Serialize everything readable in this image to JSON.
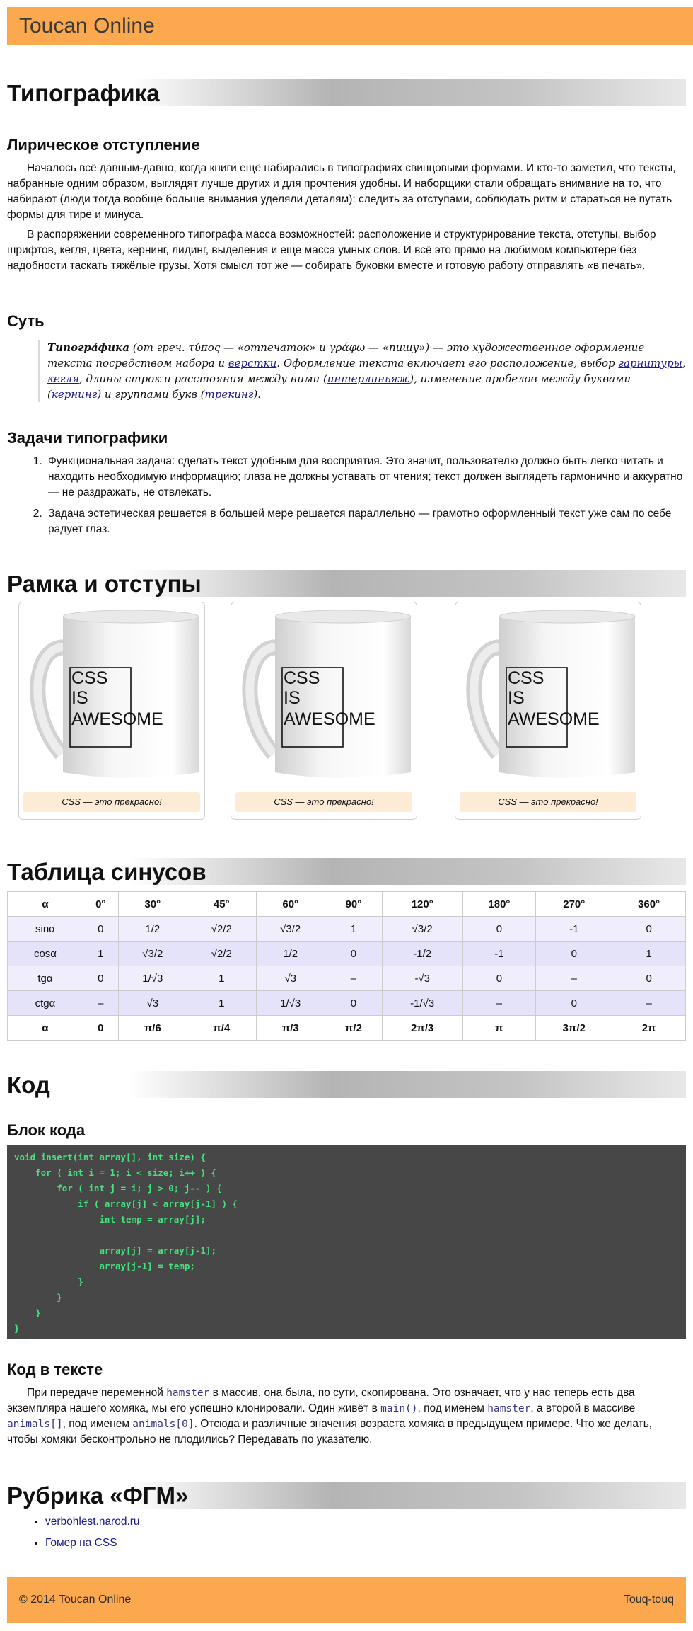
{
  "site": {
    "title": "Toucan Online"
  },
  "typography": {
    "heading": "Типографика",
    "lyric_heading": "Лирическое отступление",
    "p1": "Началось всё давным-давно, когда книги ещё набирались в типографиях свинцовыми формами. И кто-то заметил, что тексты, набранные одним образом, выглядят лучше других и для прочтения удобны. И наборщики стали обращать внимание на то, что набирают (люди тогда вообще больше внимания уделяли деталям): следить за отступами, соблюдать ритм и стараться не путать формы для тире и минуса.",
    "p2": "В распоряжении современного типографа масса возможностей: расположение и структурирование текста, отступы, выбор шрифтов, кегля, цвета, кернинг, лидинг, выделения и еще масса умных слов. И всё это прямо на любимом компьютере без надобности таскать тяжёлые грузы. Хотя смысл тот же — собирать буковки вместе и готовую работу отправлять «в печать».",
    "essence_heading": "Суть",
    "quote": {
      "term": "Типогра́фика",
      "t1": " (от греч. τύπος — «отпечаток» и γράφω — «пишу») — это художественное оформление текста посредством набора и ",
      "link_layout": "верстки",
      "t2": ". Оформление текста включает его расположение, выбор ",
      "link_typeface": "гарнитуры",
      "t3": ", ",
      "link_size": "кегля",
      "t4": ", длины строк и расстояния между ними (",
      "link_leading": "интерлиньяж",
      "t5": "), изменение пробелов между буквами (",
      "link_kerning": "кернинг",
      "t6": ") и группами букв (",
      "link_tracking": "трекинг",
      "t7": ")."
    },
    "tasks_heading": "Задачи типографики",
    "tasks": [
      "Функциональная задача: сделать текст удобным для восприятия. Это значит, пользователю должно быть легко читать и находить необходимую информацию; глаза не должны уставать от чтения; текст должен выглядеть гармонично и аккуратно — не раздражать, не отвлекать.",
      "Задача эстетическая решается в большей мере решается параллельно — грамотно оформленный текст уже сам по себе радует глаз."
    ]
  },
  "frames": {
    "heading": "Рамка и отступы",
    "mug_text": [
      "CSS",
      "IS",
      "AWESOME"
    ],
    "captions": [
      "CSS — это прекрасно!",
      "CSS — это прекрасно!",
      "CSS — это прекрасно!"
    ]
  },
  "sine_table": {
    "heading": "Таблица синусов",
    "header": [
      "α",
      "0°",
      "30°",
      "45°",
      "60°",
      "90°",
      "120°",
      "180°",
      "270°",
      "360°"
    ],
    "rows": [
      [
        "sinα",
        "0",
        "1/2",
        "√2/2",
        "√3/2",
        "1",
        "√3/2",
        "0",
        "-1",
        "0"
      ],
      [
        "cosα",
        "1",
        "√3/2",
        "√2/2",
        "1/2",
        "0",
        "-1/2",
        "-1",
        "0",
        "1"
      ],
      [
        "tgα",
        "0",
        "1/√3",
        "1",
        "√3",
        "–",
        "-√3",
        "0",
        "–",
        "0"
      ],
      [
        "ctgα",
        "–",
        "√3",
        "1",
        "1/√3",
        "0",
        "-1/√3",
        "–",
        "0",
        "–"
      ]
    ],
    "footer": [
      "α",
      "0",
      "π/6",
      "π/4",
      "π/3",
      "π/2",
      "2π/3",
      "π",
      "3π/2",
      "2π"
    ]
  },
  "code": {
    "heading": "Код",
    "block_heading": "Блок кода",
    "block": "void insert(int array[], int size) {\n    for ( int i = 1; i < size; i++ ) {\n        for ( int j = i; j > 0; j-- ) {\n            if ( array[j] < array[j-1] ) {\n                int temp = array[j];\n\n                array[j] = array[j-1];\n                array[j-1] = temp;\n            }\n        }\n    }\n}",
    "inline_heading": "Код в тексте",
    "inline": {
      "s1": "При передаче переменной ",
      "c1": "hamster",
      "s2": " в массив, она была, по сути, скопирована. Это означает, что у нас теперь есть два экземпляра нашего хомяка, мы его успешно клонировали. Один живёт в ",
      "c2": "main()",
      "s3": ", под именем ",
      "c3": "hamster",
      "s4": ", а второй в массиве ",
      "c4": "animals[]",
      "s5": ", под именем ",
      "c5": "animals[0]",
      "s6": ". Отсюда и различные значения возраста хомяка в предыдущем примере. Что же делать, чтобы хомяки бесконтрольно не плодились? Передавать по указателю."
    }
  },
  "rubric": {
    "heading": "Рубрика «ФГМ»",
    "links": [
      "verbohlest.narod.ru",
      "Гомер на CSS"
    ]
  },
  "footer": {
    "copyright": "© 2014 Toucan Online",
    "right": "Touq-touq"
  },
  "colors": {
    "accent": "#fca84e",
    "code_bg": "#474747",
    "code_fg": "#45e37f",
    "caption_bg": "#fdebd6"
  }
}
